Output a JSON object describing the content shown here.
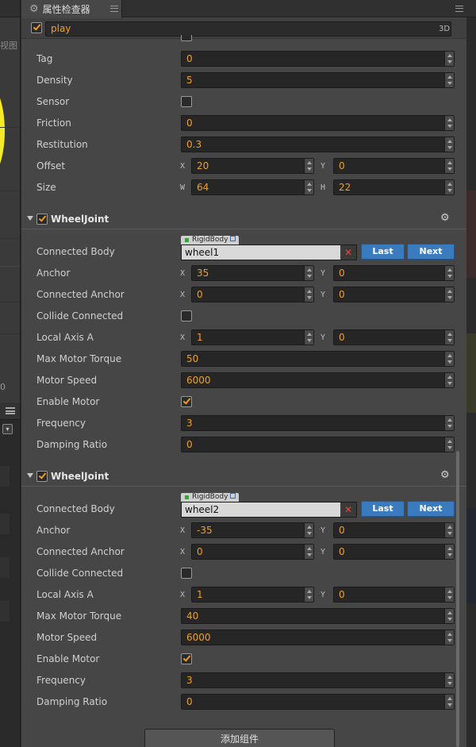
{
  "scene_panel": {
    "view_label": "视图",
    "zero_label": "0"
  },
  "inspector": {
    "tab_title": "属性检查器",
    "node": {
      "active": true,
      "name": "play",
      "mode_badge": "3D"
    },
    "collider": {
      "tag_label": "Tag",
      "tag_value": "0",
      "density_label": "Density",
      "density_value": "5",
      "sensor_label": "Sensor",
      "sensor_checked": false,
      "friction_label": "Friction",
      "friction_value": "0",
      "restitution_label": "Restitution",
      "restitution_value": "0.3",
      "offset_label": "Offset",
      "offset_x_axis": "X",
      "offset_x": "20",
      "offset_y_axis": "Y",
      "offset_y": "0",
      "size_label": "Size",
      "size_w_axis": "W",
      "size_w": "64",
      "size_h_axis": "H",
      "size_h": "22"
    },
    "joints": [
      {
        "title": "WheelJoint",
        "enabled": true,
        "connected_body_label": "Connected Body",
        "body_type_tag": "RigidBody",
        "connected_body": "wheel1",
        "last_label": "Last",
        "next_label": "Next",
        "anchor_label": "Anchor",
        "anchor_x": "35",
        "anchor_y": "0",
        "connected_anchor_label": "Connected Anchor",
        "connected_anchor_x": "0",
        "connected_anchor_y": "0",
        "collide_connected_label": "Collide Connected",
        "collide_connected": false,
        "local_axis_label": "Local Axis A",
        "local_axis_x": "1",
        "local_axis_y": "0",
        "max_motor_torque_label": "Max Motor Torque",
        "max_motor_torque": "50",
        "motor_speed_label": "Motor Speed",
        "motor_speed": "6000",
        "enable_motor_label": "Enable Motor",
        "enable_motor": true,
        "frequency_label": "Frequency",
        "frequency": "3",
        "damping_ratio_label": "Damping Ratio",
        "damping_ratio": "0",
        "axis_x": "X",
        "axis_y": "Y"
      },
      {
        "title": "WheelJoint",
        "enabled": true,
        "connected_body_label": "Connected Body",
        "body_type_tag": "RigidBody",
        "connected_body": "wheel2",
        "last_label": "Last",
        "next_label": "Next",
        "anchor_label": "Anchor",
        "anchor_x": "-35",
        "anchor_y": "0",
        "connected_anchor_label": "Connected Anchor",
        "connected_anchor_x": "0",
        "connected_anchor_y": "0",
        "collide_connected_label": "Collide Connected",
        "collide_connected": false,
        "local_axis_label": "Local Axis A",
        "local_axis_x": "1",
        "local_axis_y": "0",
        "max_motor_torque_label": "Max Motor Torque",
        "max_motor_torque": "40",
        "motor_speed_label": "Motor Speed",
        "motor_speed": "6000",
        "enable_motor_label": "Enable Motor",
        "enable_motor": true,
        "frequency_label": "Frequency",
        "frequency": "3",
        "damping_ratio_label": "Damping Ratio",
        "damping_ratio": "0",
        "axis_x": "X",
        "axis_y": "Y"
      }
    ],
    "add_component_label": "添加组件"
  },
  "colors": {
    "accent_value": "#f0a028",
    "button_blue": "#3a7bc0",
    "panel_bg": "#464646"
  }
}
